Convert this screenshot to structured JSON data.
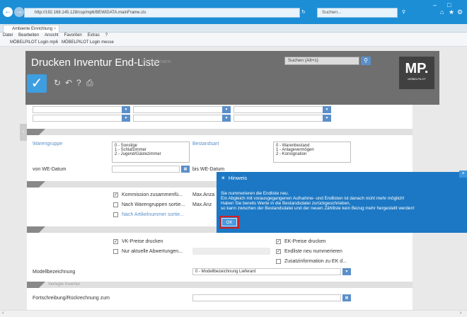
{
  "browser": {
    "url": "http://192.168.145.128/csp/mp6/BEWIDATA.mainFrame.cls",
    "search_placeholder": "Suchen...",
    "tab_title": "Ambiente Einrichtung",
    "menu": [
      "Datei",
      "Bearbeiten",
      "Ansicht",
      "Favoriten",
      "Extras",
      "?"
    ],
    "favorites": [
      "MÖBELPILOT Login mp6",
      "MÖBELPILOT Login messe"
    ]
  },
  "app": {
    "title": "Drucken Inventur End-Liste",
    "user": "Uli Floßmann",
    "search_label": "Suchen (Alt+s)",
    "logo_text": "MP.",
    "logo_sub": "MÖBELPILOT"
  },
  "form": {
    "warengruppe_label": "Warengruppe",
    "warengruppe_options": [
      "0 - Sonstige",
      "1 - Schlafzimmer",
      "2 - Jugend/Gästezimmer"
    ],
    "bestandsart_label": "Bestandsart",
    "bestandsart_options": [
      "0 - Warenbestand",
      "1 - Anlagevermögen",
      "2 - Konsignation"
    ],
    "von_we_datum": "von WE-Datum",
    "bis_we_datum": "bis WE-Datum",
    "kommission": "Kommission zusammenfü...",
    "max_anzahl_1": "Max.Anza",
    "nach_warengruppen": "Nach Warengruppen sortie...",
    "max_anzahl_2": "Max.Anz",
    "nach_artikelnummer": "Nach Artikelnummer sortie...",
    "vk_preise": "VK-Preise drucken",
    "nur_aktuelle": "Nur aktuelle Abwertungen...",
    "ek_preise": "EK-Preise drucken",
    "endliste_neu": "Endliste neu nummerieren",
    "zusatzinfo": "Zusatzinformation zu EK d...",
    "modellbezeichnung_label": "Modellbezeichnung",
    "modellbezeichnung_value": "0 - Modellbezeichnung Lieferant",
    "verlegte_inventur": "Verlegte Inventur",
    "fortschreibung": "Fortschreibung/Rückrechnung zum"
  },
  "dialog": {
    "title": "Hinweis",
    "lines": [
      "Sie nummerieren die Endliste neu.",
      "Ein Abgleich mit vorausgegangenen Aufnahme- und Endlisten ist danach nicht mehr möglich!",
      "Haben Sie bereits Werte in die Bestandsdatei zurückgeschrieben,",
      "so kann zwischen der Bestandsdatei und der neuen Zählliste kein Bezug mehr hergestellt werden!"
    ],
    "ok_label": "OK"
  },
  "colors": {
    "accent": "#1c78c4",
    "chrome": "#1c8ed6",
    "header": "#6f6f6f"
  },
  "icons": [
    "back-icon",
    "forward-icon",
    "refresh-icon",
    "search-icon",
    "home-icon",
    "star-icon",
    "gear-icon",
    "check-icon",
    "print-icon",
    "help-icon",
    "undo-icon",
    "close-icon",
    "bulb-icon"
  ]
}
